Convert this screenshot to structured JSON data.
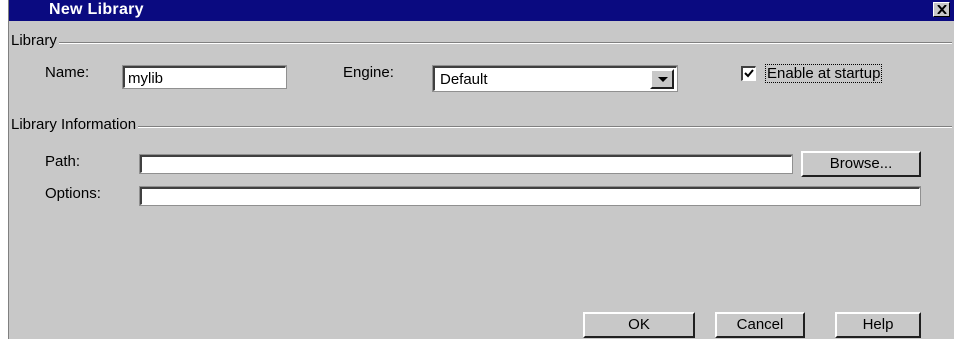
{
  "window": {
    "title": "New Library",
    "close_icon": "close-x-icon"
  },
  "library_group": {
    "label": "Library",
    "name_label": "Name:",
    "name_value": "mylib",
    "engine_label": "Engine:",
    "engine_value": "Default",
    "enable_startup_label": "Enable at startup",
    "enable_startup_checked": true
  },
  "info_group": {
    "label": "Library Information",
    "path_label": "Path:",
    "path_value": "",
    "browse_label": "Browse...",
    "options_label": "Options:",
    "options_value": ""
  },
  "buttons": {
    "ok": "OK",
    "cancel": "Cancel",
    "help": "Help"
  }
}
